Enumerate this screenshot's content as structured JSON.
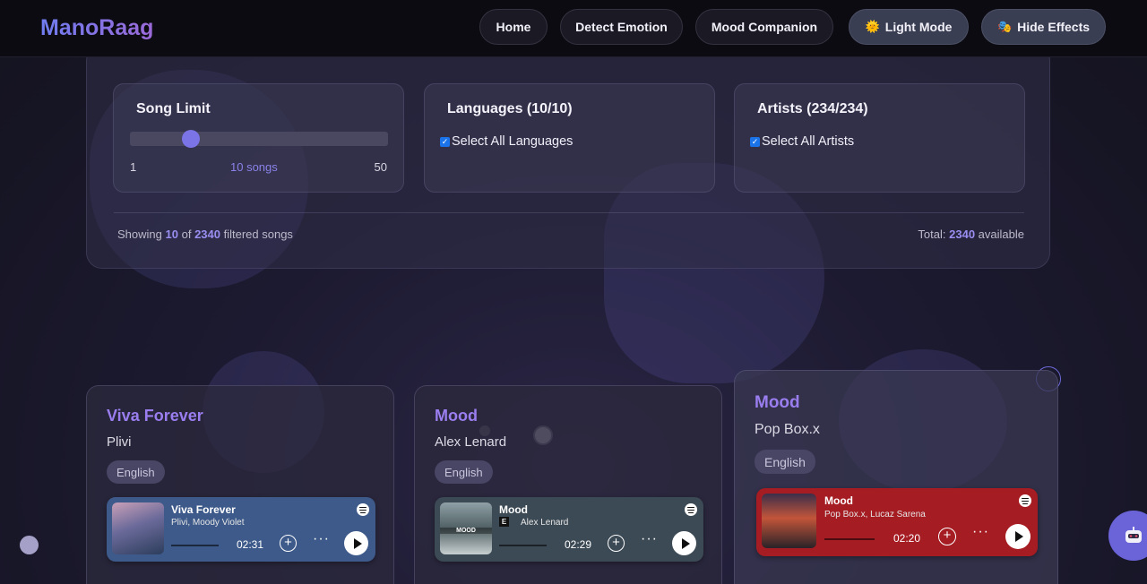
{
  "nav": {
    "brand": "ManoRaag",
    "links": [
      "Home",
      "Detect Emotion",
      "Mood Companion"
    ],
    "theme_toggle": {
      "icon": "🌞",
      "label": "Light Mode"
    },
    "effects_toggle": {
      "icon": "🎭",
      "label": "Hide Effects"
    }
  },
  "filters": {
    "song_limit": {
      "title": "Song Limit",
      "min": "1",
      "max": "50",
      "value_label": "10 songs",
      "value": 10
    },
    "languages": {
      "title": "Languages (10/10)",
      "select_all": "Select All Languages",
      "checked": true
    },
    "artists": {
      "title": "Artists (234/234)",
      "select_all": "Select All Artists",
      "checked": true
    },
    "summary": {
      "showing_prefix": "Showing",
      "showing_count": "10",
      "showing_of": "of",
      "showing_total": "2340",
      "showing_suffix": "filtered songs",
      "total_prefix": "Total:",
      "total_count": "2340",
      "total_suffix": "available"
    }
  },
  "songs": [
    {
      "title": "Viva Forever",
      "artist": "Plivi",
      "language": "English",
      "player": {
        "title": "Viva Forever",
        "artist": "Plivi, Moody Violet",
        "time": "02:31",
        "color": "#3d5a8a"
      }
    },
    {
      "title": "Mood",
      "artist": "Alex Lenard",
      "language": "English",
      "player": {
        "title": "Mood",
        "artist": "Alex Lenard",
        "explicit": "E",
        "time": "02:29",
        "color": "#3c4a55",
        "art_text": "MOOD"
      }
    },
    {
      "title": "Mood",
      "artist": "Pop Box.x",
      "language": "English",
      "player": {
        "title": "Mood",
        "artist": "Pop Box.x, Lucaz Sarena",
        "time": "02:20",
        "color": "#a51c22"
      }
    }
  ],
  "player_controls": {
    "add": "+",
    "more": "···"
  }
}
